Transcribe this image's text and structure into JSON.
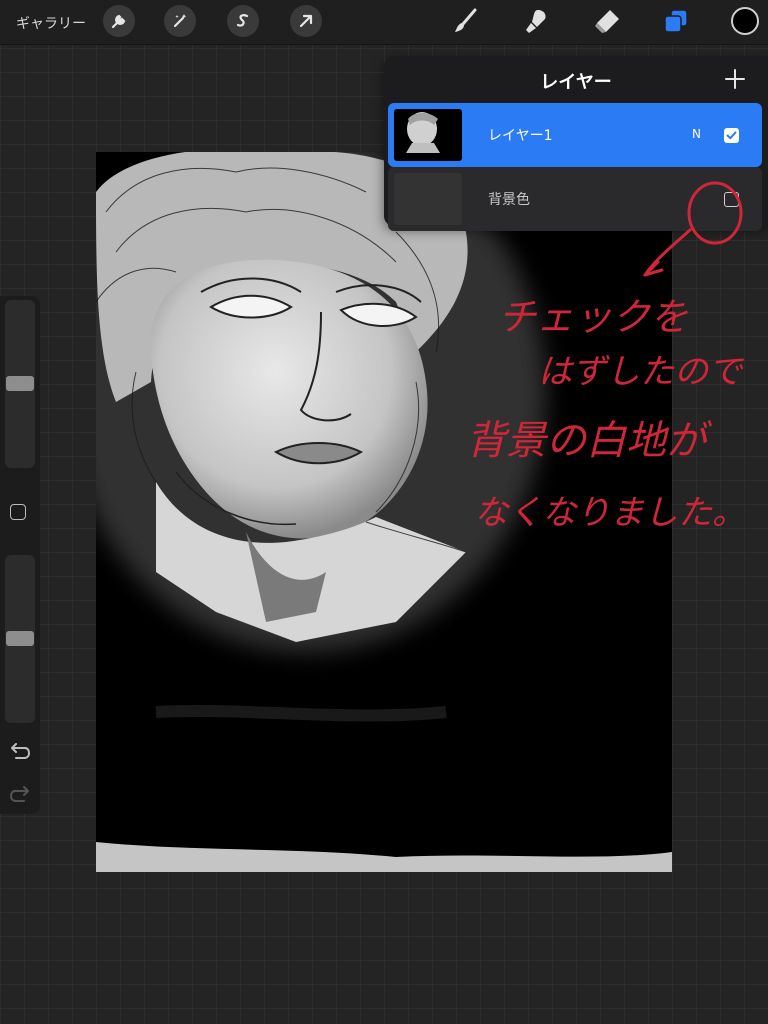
{
  "toolbar": {
    "gallery_label": "ギャラリー",
    "left_tools": [
      "wrench-icon",
      "magic-wand-icon",
      "selection-s-icon",
      "arrow-transform-icon"
    ],
    "right_tools": [
      "brush-icon",
      "smudge-icon",
      "eraser-icon",
      "layers-icon"
    ],
    "active_tool_color": "#2b7bf5",
    "current_color": "#000000"
  },
  "sidebar": {
    "brush_size_level": 0.45,
    "opacity_level": 0.55,
    "undo_icon": "undo-icon",
    "redo_icon": "redo-icon"
  },
  "layers_panel": {
    "title": "レイヤー",
    "add_icon": "plus-icon",
    "layers": [
      {
        "name": "レイヤー1",
        "blend_mode": "N",
        "visible": true,
        "selected": true
      },
      {
        "name": "背景色",
        "visible": false,
        "selected": false
      }
    ]
  },
  "annotation": {
    "lines": [
      "チェックを",
      "はずしたので",
      "背景の白地が",
      "なくなりました。"
    ],
    "color": "#d0263a"
  }
}
